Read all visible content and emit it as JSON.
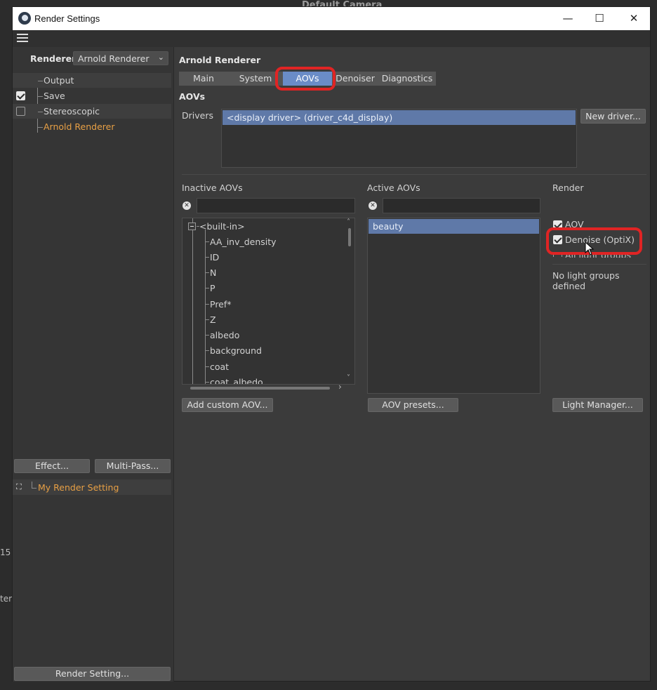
{
  "background": {
    "camera_title": "Default Camera",
    "frag_number": "15",
    "frag_text": "teri"
  },
  "window": {
    "title": "Render Settings",
    "controls": {
      "minimize": "—",
      "maximize": "☐",
      "close": "✕"
    }
  },
  "left": {
    "renderer_label": "Renderer",
    "renderer_value": "Arnold Renderer",
    "tree": [
      {
        "label": "Output",
        "checked": null
      },
      {
        "label": "Save",
        "checked": true
      },
      {
        "label": "Stereoscopic",
        "checked": false
      },
      {
        "label": "Arnold Renderer",
        "checked": null
      }
    ],
    "effect_button": "Effect...",
    "multipass_button": "Multi-Pass...",
    "render_setting_item": "My Render Setting",
    "render_setting_button": "Render Setting..."
  },
  "right": {
    "header": "Arnold Renderer",
    "tabs": [
      "Main",
      "System",
      "AOVs",
      "Denoiser",
      "Diagnostics"
    ],
    "active_tab": "AOVs",
    "section_title": "AOVs",
    "drivers_label": "Drivers",
    "driver_selected": "<display driver> (driver_c4d_display)",
    "new_driver_button": "New driver...",
    "inactive_label": "Inactive AOVs",
    "active_label": "Active AOVs",
    "render_label": "Render",
    "inactive_root": "<built-in>",
    "inactive_items": [
      "AA_inv_density",
      "ID",
      "N",
      "P",
      "Pref*",
      "Z",
      "albedo",
      "background",
      "coat",
      "coat_albedo"
    ],
    "active_items": [
      "beauty"
    ],
    "render_options": [
      {
        "label": "AOV",
        "checked": true
      },
      {
        "label": "Denoise (OptiX)",
        "checked": true
      },
      {
        "label": "All light groups",
        "checked": false
      }
    ],
    "no_light_groups": "No light groups defined",
    "add_custom_button": "Add custom AOV...",
    "aov_presets_button": "AOV presets...",
    "light_manager_button": "Light Manager..."
  },
  "colors": {
    "highlight_ring": "#e02424",
    "active_tab": "#6a8cc7",
    "orange_text": "#e8a045"
  }
}
